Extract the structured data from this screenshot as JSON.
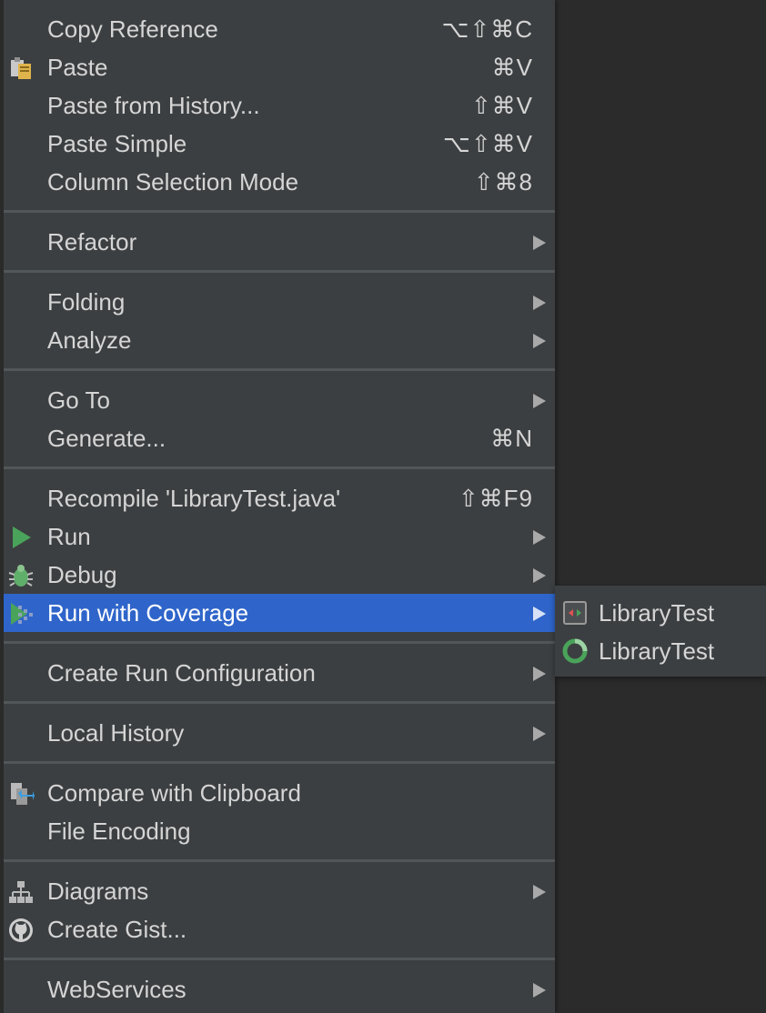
{
  "menu": {
    "groups": [
      [
        {
          "label": "Copy Reference",
          "shortcut": "⌥⇧⌘C",
          "icon": null
        },
        {
          "label": "Paste",
          "shortcut": "⌘V",
          "icon": "paste-icon"
        },
        {
          "label": "Paste from History...",
          "shortcut": "⇧⌘V",
          "icon": null
        },
        {
          "label": "Paste Simple",
          "shortcut": "⌥⇧⌘V",
          "icon": null
        },
        {
          "label": "Column Selection Mode",
          "shortcut": "⇧⌘8",
          "icon": null
        }
      ],
      [
        {
          "label": "Refactor",
          "submenu": true,
          "icon": null
        }
      ],
      [
        {
          "label": "Folding",
          "submenu": true,
          "icon": null
        },
        {
          "label": "Analyze",
          "submenu": true,
          "icon": null
        }
      ],
      [
        {
          "label": "Go To",
          "submenu": true,
          "icon": null
        },
        {
          "label": "Generate...",
          "shortcut": "⌘N",
          "icon": null
        }
      ],
      [
        {
          "label": "Recompile 'LibraryTest.java'",
          "shortcut": "⇧⌘F9",
          "icon": null
        },
        {
          "label": "Run",
          "submenu": true,
          "icon": "run-icon"
        },
        {
          "label": "Debug",
          "submenu": true,
          "icon": "debug-icon"
        },
        {
          "label": "Run with Coverage",
          "submenu": true,
          "icon": "coverage-icon",
          "selected": true
        }
      ],
      [
        {
          "label": "Create Run Configuration",
          "submenu": true,
          "icon": null
        }
      ],
      [
        {
          "label": "Local History",
          "submenu": true,
          "icon": null
        }
      ],
      [
        {
          "label": "Compare with Clipboard",
          "icon": "compare-icon"
        },
        {
          "label": "File Encoding",
          "icon": null
        }
      ],
      [
        {
          "label": "Diagrams",
          "submenu": true,
          "icon": "diagrams-icon"
        },
        {
          "label": "Create Gist...",
          "icon": "github-icon"
        }
      ],
      [
        {
          "label": "WebServices",
          "submenu": true,
          "icon": null
        }
      ]
    ]
  },
  "submenu": {
    "items": [
      {
        "label": "LibraryTest",
        "icon": "test-config-icon"
      },
      {
        "label": "LibraryTest",
        "icon": "junit-icon"
      }
    ]
  },
  "colors": {
    "menu_bg": "#3c3f41",
    "selection": "#2f65ca",
    "text": "#d5d5d5",
    "separator": "#515658"
  }
}
